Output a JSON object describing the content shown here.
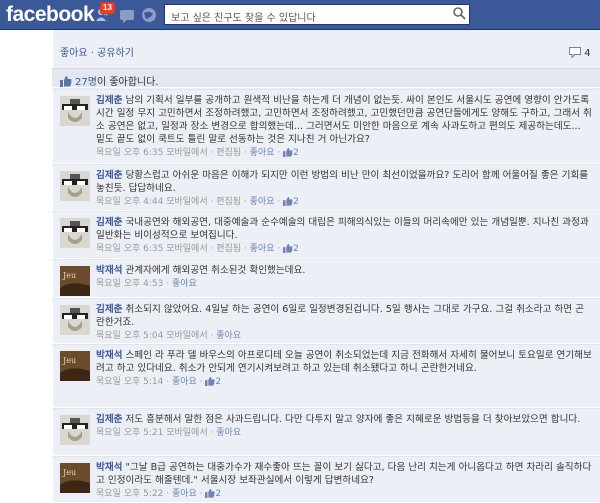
{
  "app": {
    "logo": "facebook",
    "notification_count": "13"
  },
  "search": {
    "placeholder": "보고 싶은 친구도 찾을 수 있답니다"
  },
  "post_actions": {
    "like": "좋아요",
    "separator": " · ",
    "share": "공유하기"
  },
  "comment_count": "4",
  "likes": {
    "text_prefix": "27명",
    "text_suffix": "이 좋아합니다."
  },
  "comments": [
    {
      "author": "김제춘",
      "text": "남의 기획서 일부를 공개하고 원색적 비난을 하는게 더 개념이 없는듯. 싸이 본인도 서울시도 공연에 영향이 안가도록 시간 일정 무지 고민하면서 조정하려했고, 고민하면서 조정하려했고, 고민했던만큼 공연단들에게도 양해도 구하고, 그래서 취소 공연은 없고, 일정과 장소 변경으로 합의했는데... 그러면서도 미안한 마음으로 계속 사과도하고 편의도 제공하는데도... 밑도 끝도 없이 쿡트도 틀린 말로 선동하는 것은 지나친 거 아닌가요?",
      "time": "목요일 오후 6:35",
      "via": "모바일에서",
      "edited": "편집됨",
      "like": "좋아요",
      "like_count": "2",
      "avatar": "kim"
    },
    {
      "author": "김제춘",
      "text": "당황스럽고 아쉬운 마음은 이해가 되지만 이런 방법의 비난 만이 최선이었을까요? 도리어 함께 어울어질 좋은 기회를 놓친듯. 답답하네요.",
      "time": "목요일 오후 4:44",
      "via": "모바일에서",
      "edited": "편집됨",
      "like": "좋아요",
      "like_count": "2",
      "avatar": "kim"
    },
    {
      "author": "김제춘",
      "text": "국내공연와 해외공연, 대중예술과 순수예술의 대립은 피해의식있는 이들의 머리속에만 있는 개념일뿐. 지나친 과정과 일반화는 비이성적으로 보여집니다.",
      "time": "목요일 오후 6:35",
      "via": "모바일에서",
      "edited": "편집됨",
      "like": "좋아요",
      "like_count": "2",
      "avatar": "kim"
    },
    {
      "author": "박재석",
      "text": "관계자에게 해외공연 취소된것 확인했는데요.",
      "time": "목요일 오후 4:53",
      "via": "",
      "edited": "",
      "like": "좋아요",
      "like_count": "",
      "avatar": "park"
    },
    {
      "author": "김제춘",
      "text": "취소되지 않았어요. 4일날 하는 공연이 6일로 일정변경된겁니다. 5일 행사는 그대로 가구요. 그걸 취소라고 하면 곤란한거죠.",
      "time": "목요일 오후 5:04",
      "via": "모바일에서",
      "edited": "",
      "like": "좋아요",
      "like_count": "",
      "avatar": "kim"
    },
    {
      "author": "박재석",
      "text": "스페인 라 푸라 델 바우스의 아프로디테 오늘 공연이 취소되었는데 지금 전화해서 자세히 물어보니 토요일로 연기해보려고 하고 있다네요. 취소가 안되게 연기시켜보려고 하고 있는데 취소됐다고 하니 곤란한거네요.",
      "time": "목요일 오후 5:14",
      "via": "",
      "edited": "",
      "like": "좋아요",
      "like_count": "2",
      "avatar": "park"
    },
    {
      "author": "김제춘",
      "text": "저도 흥분해서 말한 점은 사과드립니다. 다만 다투지 말고 양자에 좋은 지혜로운 방법등을 더 찾아보았으면 합니다.",
      "time": "목요일 오후 5:21",
      "via": "모바일에서",
      "edited": "",
      "like": "좋아요",
      "like_count": "",
      "avatar": "kim"
    },
    {
      "author": "박재석",
      "text": "\"그날 B급 공연하는 대중가수가 재수좋아 뜨는 꼴이 보기 싫다고, 다음 난리 치는게 아니옵다고 하면 차라리 솔직하다고 인정이라도 해줄텐데.\" 서울시장 보좌관실에서 이렇게 답변하네요?",
      "time": "목요일 오후 5:22",
      "via": "",
      "edited": "",
      "like": "좋아요",
      "like_count": "2",
      "avatar": "park"
    }
  ],
  "colors": {
    "brand": "#3b5998",
    "panel": "#eceff5",
    "link": "#3b5998"
  }
}
